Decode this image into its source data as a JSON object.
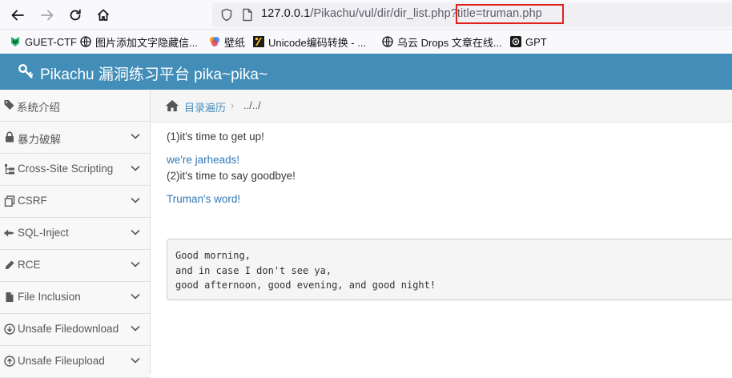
{
  "browser": {
    "url_host": "127.0.0.1",
    "url_path": "/Pikachu/vul/dir/dir_list.php",
    "url_query": "?title=truman.php",
    "back_icon": "arrow-left-icon",
    "forward_icon": "arrow-right-icon",
    "reload_icon": "reload-icon",
    "home_icon": "home-icon",
    "highlight_color": "#e0201c"
  },
  "bookmarks": [
    {
      "label": "GUET-CTF",
      "icon": "guet-icon"
    },
    {
      "label": "图片添加文字隐藏信...",
      "icon": "image-icon"
    },
    {
      "label": "壁纸",
      "icon": "wallpaper-icon"
    },
    {
      "label": "Unicode编码转换 - ...",
      "icon": "unicode-icon"
    },
    {
      "label": "乌云 Drops 文章在线...",
      "icon": "globe-icon"
    },
    {
      "label": "GPT",
      "icon": "openai-icon"
    }
  ],
  "app": {
    "title": "Pikachu 漏洞练习平台 pika~pika~",
    "header_color": "#438eb9"
  },
  "sidebar": {
    "items": [
      {
        "label": "系统介绍",
        "icon": "tags-icon",
        "has_chevron": false
      },
      {
        "label": "暴力破解",
        "icon": "lock-icon",
        "has_chevron": true
      },
      {
        "label": "Cross-Site Scripting",
        "icon": "sitemap-icon",
        "has_chevron": true
      },
      {
        "label": "CSRF",
        "icon": "copy-icon",
        "has_chevron": true
      },
      {
        "label": "SQL-Inject",
        "icon": "fighter-jet-icon",
        "has_chevron": true
      },
      {
        "label": "RCE",
        "icon": "pencil-icon",
        "has_chevron": true
      },
      {
        "label": "File Inclusion",
        "icon": "file-icon",
        "has_chevron": true
      },
      {
        "label": "Unsafe Filedownload",
        "icon": "download-icon",
        "has_chevron": true
      },
      {
        "label": "Unsafe Fileupload",
        "icon": "upload-icon",
        "has_chevron": true
      }
    ]
  },
  "breadcrumb": {
    "link": "目录遍历",
    "separator": "›",
    "current": "../../"
  },
  "content": {
    "line1": "(1)it's time to get up!",
    "link1": "we're jarheads!",
    "line2": "(2)it's time to say goodbye!",
    "link2": "Truman's word!",
    "code_lines": [
      "Good morning,",
      "and in case I don't see ya,",
      "good afternoon, good evening, and good night!"
    ]
  }
}
